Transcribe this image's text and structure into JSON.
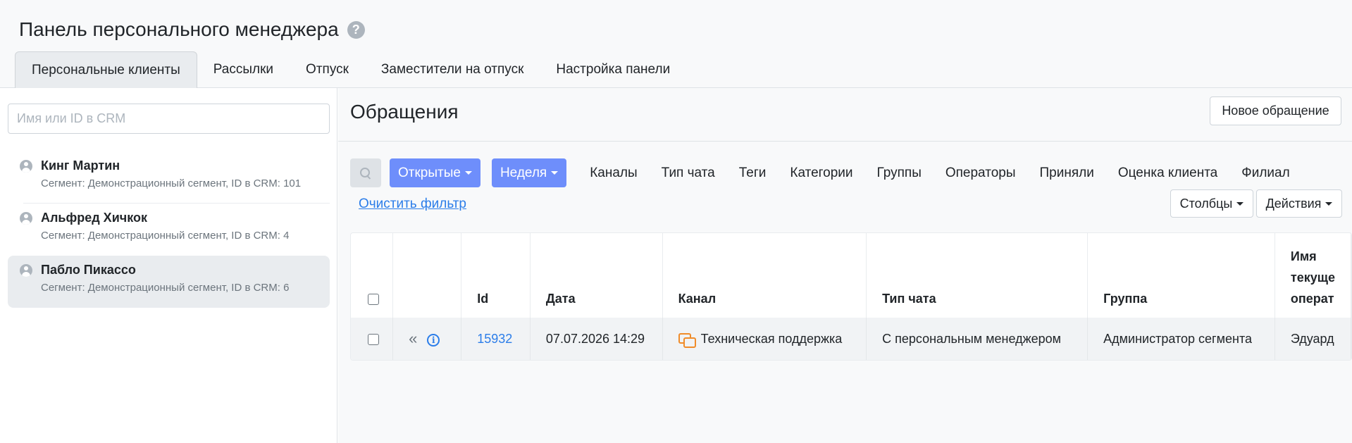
{
  "header": {
    "title": "Панель персонального менеджера",
    "help_icon": "question-circle-icon",
    "tabs": [
      {
        "label": "Персональные клиенты",
        "active": true
      },
      {
        "label": "Рассылки"
      },
      {
        "label": "Отпуск"
      },
      {
        "label": "Заместители на отпуск"
      },
      {
        "label": "Настройка панели"
      }
    ]
  },
  "sidebar": {
    "search_placeholder": "Имя или ID в CRM",
    "clients": [
      {
        "name": "Кинг Мартин",
        "meta": "Сегмент: Демонстрационный сегмент, ID в CRM: 101"
      },
      {
        "name": "Альфред Хичкок",
        "meta": "Сегмент: Демонстрационный сегмент, ID в CRM: 4"
      },
      {
        "name": "Пабло Пикассо",
        "meta": "Сегмент: Демонстрационный сегмент, ID в CRM: 6",
        "selected": true
      }
    ]
  },
  "main": {
    "title": "Обращения",
    "new_request_label": "Новое обращение",
    "filters": {
      "status_label": "Открытые",
      "period_label": "Неделя",
      "links": [
        "Каналы",
        "Тип чата",
        "Теги",
        "Категории",
        "Группы",
        "Операторы",
        "Приняли",
        "Оценка клиента",
        "Филиал"
      ],
      "clear_label": "Очистить фильтр",
      "columns_label": "Столбцы",
      "actions_label": "Действия"
    },
    "table": {
      "headers": {
        "id": "Id",
        "date": "Дата",
        "channel": "Канал",
        "chat_type": "Тип чата",
        "group": "Группа",
        "operator_line1": "Имя",
        "operator_line2": "текуще",
        "operator_line3": "операт"
      },
      "rows": [
        {
          "id": "15932",
          "date": "07.07.2026 14:29",
          "channel": "Техническая поддержка",
          "chat_type": "С персональным менеджером",
          "group": "Администратор сегмента",
          "operator": "Эдуард"
        }
      ]
    },
    "colors": {
      "primary": "#6e8efb",
      "link": "#2b7de9",
      "channel_icon": "#f08c2a"
    }
  }
}
